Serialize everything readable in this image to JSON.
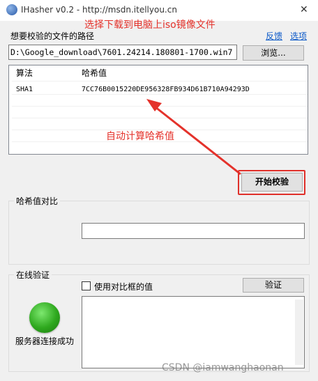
{
  "window": {
    "title": "IHasher v0.2 - http://msdn.itellyou.cn",
    "close_glyph": "✕"
  },
  "annotations": {
    "top": "选择下载到电脑上iso镜像文件",
    "middle": "自动计算哈希值",
    "arrow_color": "#e4322b"
  },
  "file_section": {
    "label": "想要校验的文件的路径",
    "links": [
      "反馈",
      "选项"
    ],
    "path_value": "D:\\Google_download\\7601.24214.180801-1700.win7",
    "browse_label": "浏览..."
  },
  "hash_table": {
    "columns": [
      "算法",
      "哈希值"
    ],
    "rows": [
      {
        "algorithm": "SHA1",
        "hash": "7CC76B0015220DE956328FB934D61B710A94293D"
      }
    ]
  },
  "start_button": "开始校验",
  "compare_group": {
    "label": "哈希值对比",
    "value": ""
  },
  "online_group": {
    "label": "在线验证",
    "checkbox_label": "使用对比框的值",
    "checkbox_checked": false,
    "verify_label": "验证",
    "status_text": "服务器连接成功",
    "status_color": "#2ea81e",
    "output": ""
  },
  "watermark": "CSDN @iamwanghaonan"
}
